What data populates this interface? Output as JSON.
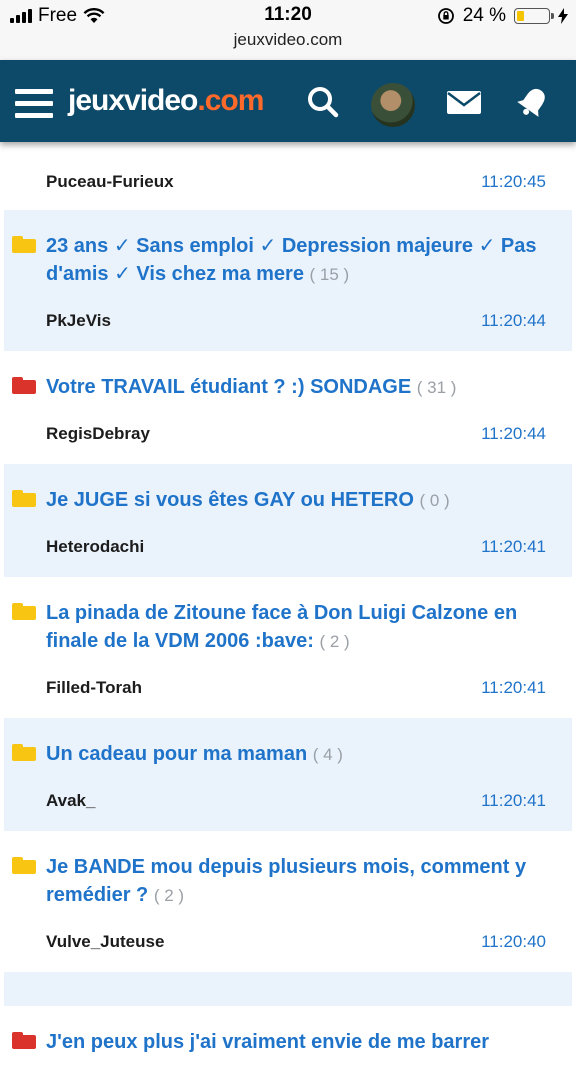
{
  "status_bar": {
    "carrier": "Free",
    "time": "11:20",
    "battery_percent": "24 %",
    "battery_level": 0.24,
    "url": "jeuxvideo.com"
  },
  "header": {
    "logo_main": "jeuxvideo",
    "logo_accent": ".com",
    "colors": {
      "background": "#0d4968",
      "accent": "#ff6a2b",
      "link": "#1f73c9"
    },
    "icons": [
      "menu-icon",
      "search-icon",
      "avatar",
      "mail-icon",
      "bell-icon"
    ]
  },
  "previous_topic": {
    "author": "Puceau-Furieux",
    "time": "11:20:45"
  },
  "topics": [
    {
      "title": "23 ans ✓ Sans emploi ✓ Depression majeure ✓ Pas d'amis ✓ Vis chez ma mere",
      "count": "( 15 )",
      "author": "PkJeVis",
      "time": "11:20:44",
      "folder": "yellow"
    },
    {
      "title": "Votre TRAVAIL étudiant ? :) SONDAGE",
      "count": "( 31 )",
      "author": "RegisDebray",
      "time": "11:20:44",
      "folder": "red"
    },
    {
      "title": "Je JUGE si vous êtes GAY ou HETERO",
      "count": "( 0 )",
      "author": "Heterodachi",
      "time": "11:20:41",
      "folder": "yellow"
    },
    {
      "title": "La pinada de Zitoune face à Don Luigi Calzone en finale de la VDM 2006 :bave:",
      "count": "( 2 )",
      "author": "Filled-Torah",
      "time": "11:20:41",
      "folder": "yellow"
    },
    {
      "title": "Un cadeau pour ma maman",
      "count": "( 4 )",
      "author": "Avak_",
      "time": "11:20:41",
      "folder": "yellow"
    },
    {
      "title": "Je BANDE mou depuis plusieurs mois, comment y remédier ?",
      "count": "( 2 )",
      "author": "Vulve_Juteuse",
      "time": "11:20:40",
      "folder": "yellow"
    }
  ],
  "last_topic": {
    "title": "J'en peux plus j'ai vraiment envie de me barrer",
    "folder": "red"
  }
}
